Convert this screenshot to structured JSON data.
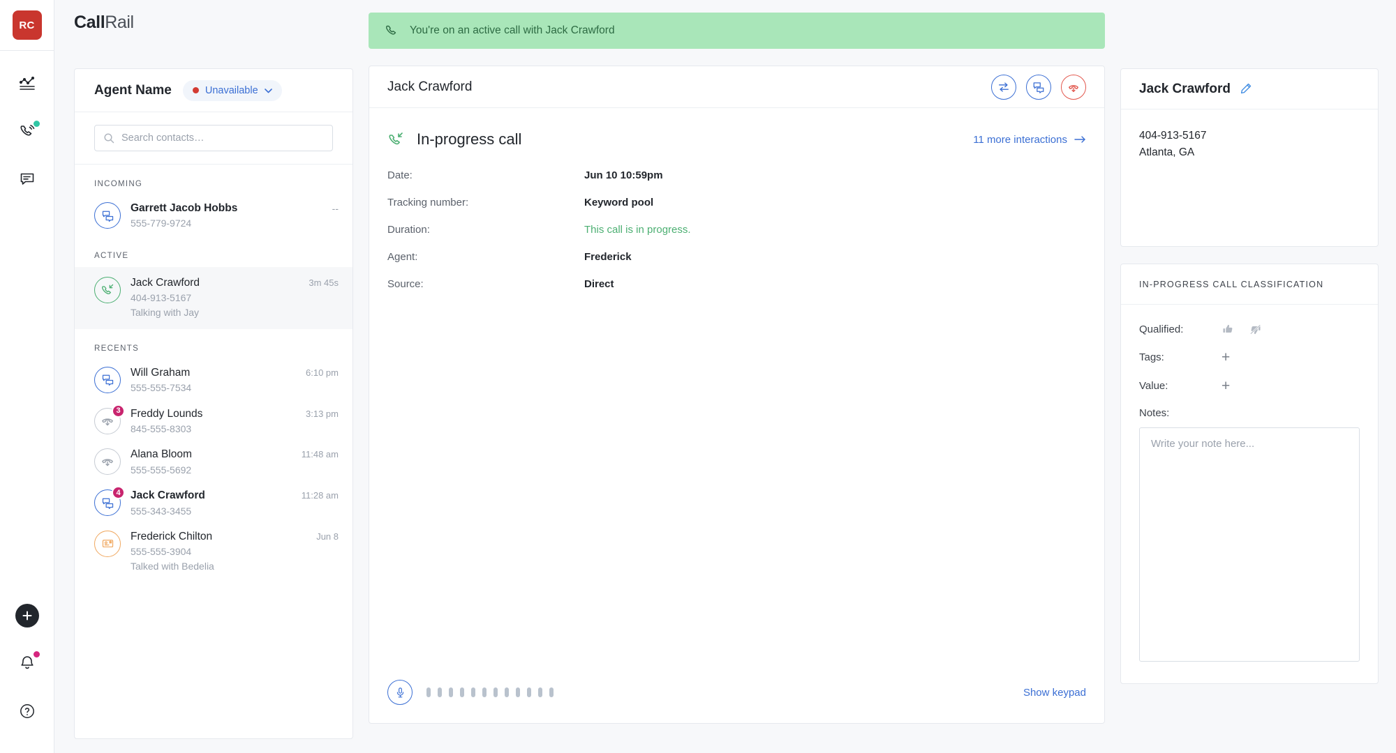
{
  "brand": {
    "bold": "Call",
    "light": "Rail"
  },
  "rail": {
    "logo_initials": "RC",
    "icons": [
      {
        "name": "analytics-icon"
      },
      {
        "name": "phone-calls-icon"
      },
      {
        "name": "messages-icon"
      }
    ],
    "bottom": [
      {
        "name": "add-button"
      },
      {
        "name": "notifications-bell"
      },
      {
        "name": "help-button"
      }
    ]
  },
  "sidebar": {
    "agent_name": "Agent Name",
    "status": "Unavailable",
    "search": {
      "value": "",
      "placeholder": "Search contacts…"
    },
    "groups": [
      {
        "label": "INCOMING",
        "contacts": [
          {
            "name": "Garrett Jacob Hobbs",
            "phone": "555-779-9724",
            "sub": "",
            "time": "--",
            "badge": "",
            "icon": "message-bubbles-icon",
            "color": "blue",
            "bold": true,
            "active": false
          }
        ]
      },
      {
        "label": "ACTIVE",
        "contacts": [
          {
            "name": "Jack Crawford",
            "phone": "404-913-5167",
            "sub": "Talking with Jay",
            "time": "3m 45s",
            "badge": "",
            "icon": "incoming-call-icon",
            "color": "green",
            "bold": false,
            "active": true
          }
        ]
      },
      {
        "label": "RECENTS",
        "contacts": [
          {
            "name": "Will Graham",
            "phone": "555-555-7534",
            "sub": "",
            "time": "6:10 pm",
            "badge": "",
            "icon": "message-bubbles-icon",
            "color": "blue",
            "bold": false,
            "active": false
          },
          {
            "name": "Freddy Lounds",
            "phone": "845-555-8303",
            "sub": "",
            "time": "3:13 pm",
            "badge": "3",
            "icon": "voicemail-icon",
            "color": "grey",
            "bold": false,
            "active": false
          },
          {
            "name": "Alana Bloom",
            "phone": "555-555-5692",
            "sub": "",
            "time": "11:48 am",
            "badge": "",
            "icon": "voicemail-icon",
            "color": "grey",
            "bold": false,
            "active": false
          },
          {
            "name": "Jack Crawford",
            "phone": "555-343-3455",
            "sub": "",
            "time": "11:28 am",
            "badge": "4",
            "icon": "message-bubbles-icon",
            "color": "blue",
            "bold": true,
            "active": false
          },
          {
            "name": "Frederick Chilton",
            "phone": "555-555-3904",
            "sub": "Talked with Bedelia",
            "time": "Jun 8",
            "badge": "",
            "icon": "form-submission-icon",
            "color": "orange",
            "bold": false,
            "active": false
          }
        ]
      }
    ]
  },
  "banner": {
    "text": "You're on an active call with Jack Crawford",
    "icon": "phone-icon"
  },
  "call": {
    "header_title": "Jack Crawford",
    "actions": [
      {
        "name": "transfer-call-button",
        "icon": "transfer-icon"
      },
      {
        "name": "send-message-button",
        "icon": "message-bubbles-icon"
      },
      {
        "name": "end-call-button",
        "icon": "hangup-icon"
      }
    ],
    "section_title": "In-progress call",
    "more_link": "11 more interactions",
    "details": [
      {
        "label": "Date:",
        "value": "Jun 10 10:59pm",
        "style": "bold"
      },
      {
        "label": "Tracking number:",
        "value": "Keyword pool",
        "style": "bold"
      },
      {
        "label": "Duration:",
        "value": "This call is in progress.",
        "style": "green"
      },
      {
        "label": "Agent:",
        "value": "Frederick",
        "style": "bold"
      },
      {
        "label": "Source:",
        "value": "Direct",
        "style": "bold"
      }
    ],
    "keypad_link": "Show keypad",
    "meter_bars": 12
  },
  "contact_panel": {
    "title": "Jack Crawford",
    "lines": [
      "404-913-5167",
      "Atlanta, GA"
    ]
  },
  "classification": {
    "title": "IN-PROGRESS CALL CLASSIFICATION",
    "rows": [
      {
        "label": "Qualified:",
        "type": "thumbs"
      },
      {
        "label": "Tags:",
        "type": "plus",
        "plus": "+"
      },
      {
        "label": "Value:",
        "type": "plus",
        "plus": "+"
      }
    ],
    "notes_label": "Notes:",
    "notes": {
      "value": "",
      "placeholder": "Write your note here..."
    }
  },
  "colors": {
    "brand_red": "#c9362e",
    "accent_blue": "#3b6fd4",
    "success_green": "#4caf72",
    "banner_green": "#a9e6b9",
    "badge_pink": "#c8246e",
    "danger_red": "#e2564c"
  }
}
